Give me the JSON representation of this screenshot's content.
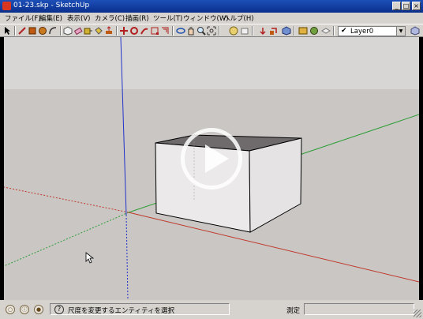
{
  "window": {
    "title": "01-23.skp - SketchUp",
    "minimize": "_",
    "maximize": "□",
    "close": "×"
  },
  "menu": [
    {
      "label": "ファイル(F)"
    },
    {
      "label": "編集(E)"
    },
    {
      "label": "表示(V)"
    },
    {
      "label": "カメラ(C)"
    },
    {
      "label": "描画(R)"
    },
    {
      "label": "ツール(T)"
    },
    {
      "label": "ウィンドウ(W)"
    },
    {
      "label": "ヘルプ(H)"
    }
  ],
  "toolbar": {
    "tools": [
      "select-icon",
      "line-icon",
      "rectangle-icon",
      "circle-icon",
      "arc-icon",
      "make-component-icon",
      "eraser-icon",
      "tape-measure-icon",
      "paint-bucket-icon",
      "push-pull-icon",
      "move-icon",
      "rotate-icon",
      "follow-me-icon",
      "scale-icon",
      "offset-icon",
      "orbit-icon",
      "pan-icon",
      "zoom-icon",
      "zoom-extents-icon",
      "walk-icon",
      "section-icon",
      "previous-view-icon",
      "next-view-icon",
      "standard-views-icon",
      "component-browser-icon",
      "material-browser-icon",
      "layer-manager-icon"
    ],
    "layer": {
      "check": "✔",
      "name": "Layer0"
    }
  },
  "colors": {
    "x_axis": "#c0392b",
    "y_axis": "#2e9e36",
    "z_axis": "#2233c8",
    "face_front": "#ece9ea",
    "face_top": "#6f6b6c"
  },
  "status": {
    "help": "?",
    "text": "尺度を変更するエンティティを選択",
    "measure_label": "測定"
  }
}
